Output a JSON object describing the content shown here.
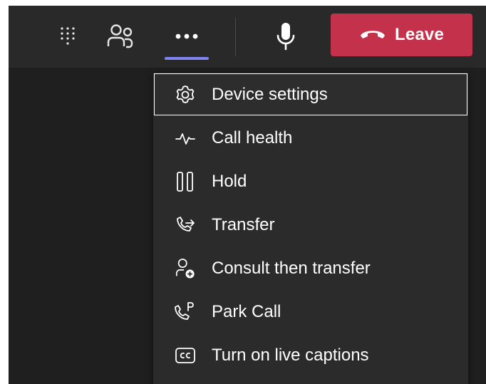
{
  "toolbar": {
    "buttons": [
      {
        "name": "dialpad",
        "icon": "dialpad-icon"
      },
      {
        "name": "participants",
        "icon": "people-icon"
      },
      {
        "name": "more-actions",
        "icon": "more-horizontal-icon",
        "active": true
      },
      {
        "name": "microphone",
        "icon": "microphone-icon"
      }
    ],
    "leave_label": "Leave",
    "leave_icon": "hang-up-icon",
    "leave_color": "#c4314b",
    "active_accent": "#7f85f5"
  },
  "menu": {
    "items": [
      {
        "label": "Device settings",
        "icon": "gear-icon",
        "focused": true
      },
      {
        "label": "Call health",
        "icon": "pulse-icon"
      },
      {
        "label": "Hold",
        "icon": "pause-icon"
      },
      {
        "label": "Transfer",
        "icon": "phone-transfer-icon"
      },
      {
        "label": "Consult then transfer",
        "icon": "person-add-icon"
      },
      {
        "label": "Park Call",
        "icon": "phone-park-icon"
      },
      {
        "label": "Turn on live captions",
        "icon": "closed-captions-icon"
      }
    ]
  }
}
